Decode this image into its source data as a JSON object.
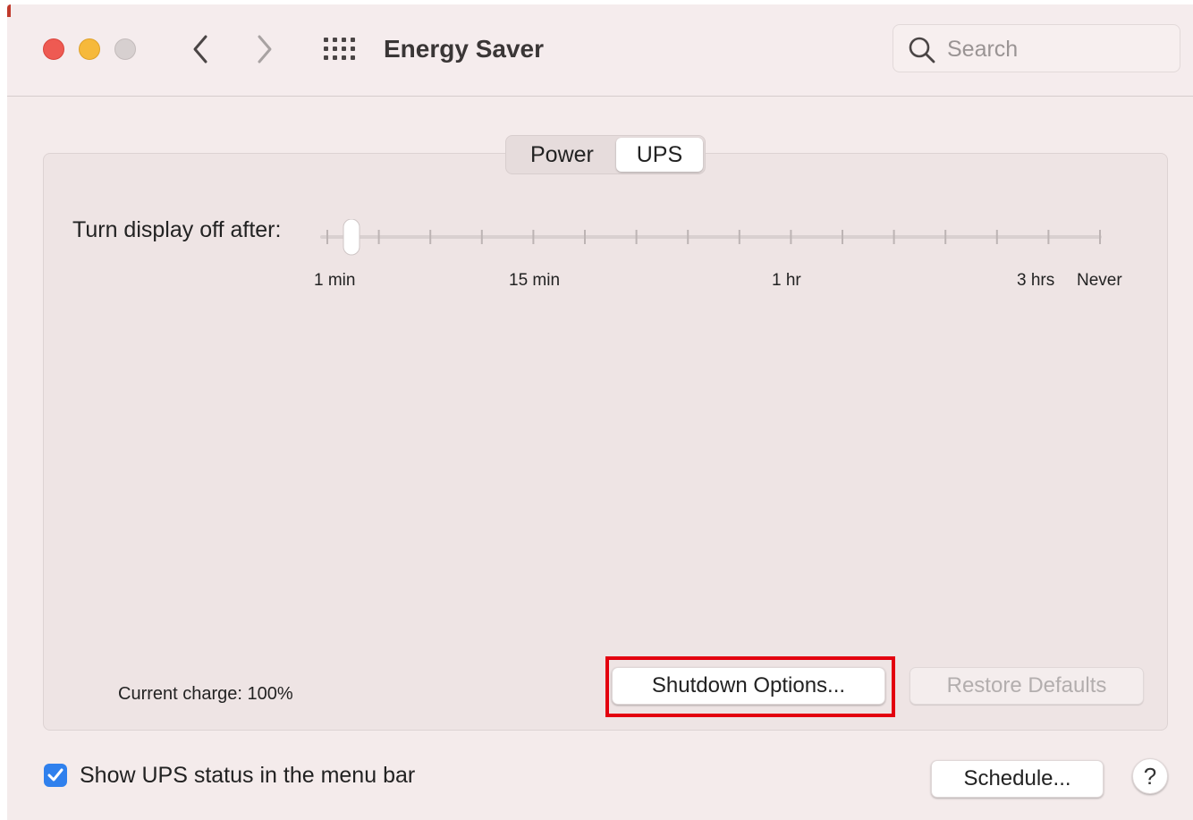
{
  "window": {
    "title": "Energy Saver"
  },
  "search": {
    "placeholder": "Search",
    "value": ""
  },
  "tabs": [
    {
      "label": "Power",
      "selected": false
    },
    {
      "label": "UPS",
      "selected": true
    }
  ],
  "display_slider": {
    "label": "Turn display off after:",
    "tick_labels": [
      "1 min",
      "15 min",
      "1 hr",
      "3 hrs",
      "Never"
    ],
    "tick_count": 16,
    "selected_index": 0,
    "selected_value": "1 min"
  },
  "status": {
    "current_charge": "Current charge: 100%"
  },
  "buttons": {
    "shutdown_options": "Shutdown Options...",
    "restore_defaults": "Restore Defaults",
    "schedule": "Schedule...",
    "help": "?"
  },
  "menu_bar_option": {
    "label": "Show UPS status in the menu bar",
    "checked": true
  },
  "colors": {
    "close": "#ee5a52",
    "minimize": "#f6b93b",
    "zoom": "#d7d0d0",
    "accent": "#2f80ed",
    "highlight": "#e3000f"
  }
}
